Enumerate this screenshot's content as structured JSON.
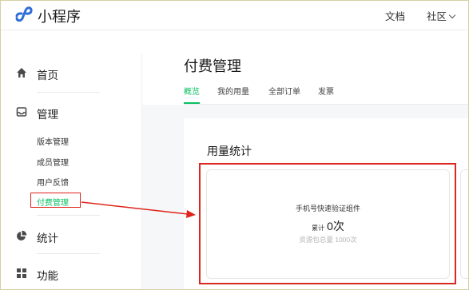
{
  "topbar": {
    "app_name": "小程序",
    "docs_label": "文档",
    "community_label": "社区",
    "logo_icon": "mini-program-logo-icon"
  },
  "sidebar": {
    "home": {
      "label": "首页",
      "icon": "home-icon"
    },
    "manage": {
      "label": "管理",
      "icon": "inbox-icon",
      "items": [
        {
          "label": "版本管理"
        },
        {
          "label": "成员管理"
        },
        {
          "label": "用户反馈"
        },
        {
          "label": "付费管理",
          "active": true
        }
      ]
    },
    "stats": {
      "label": "统计",
      "icon": "pie-chart-icon"
    },
    "features": {
      "label": "功能",
      "icon": "grid-icon"
    }
  },
  "main": {
    "page_title": "付费管理",
    "tabs": [
      {
        "label": "概览",
        "active": true
      },
      {
        "label": "我的用量"
      },
      {
        "label": "全部订单"
      },
      {
        "label": "发票"
      }
    ],
    "usage_title": "用量统计",
    "usage_card": {
      "component_name": "手机号快速验证组件",
      "count_label": "累计",
      "count_value": "0次",
      "quota_text": "资源包总量 1000次"
    }
  },
  "colors": {
    "accent": "#07c160",
    "annotation_red": "#e0231c",
    "logo_blue": "#2f6dd6"
  }
}
